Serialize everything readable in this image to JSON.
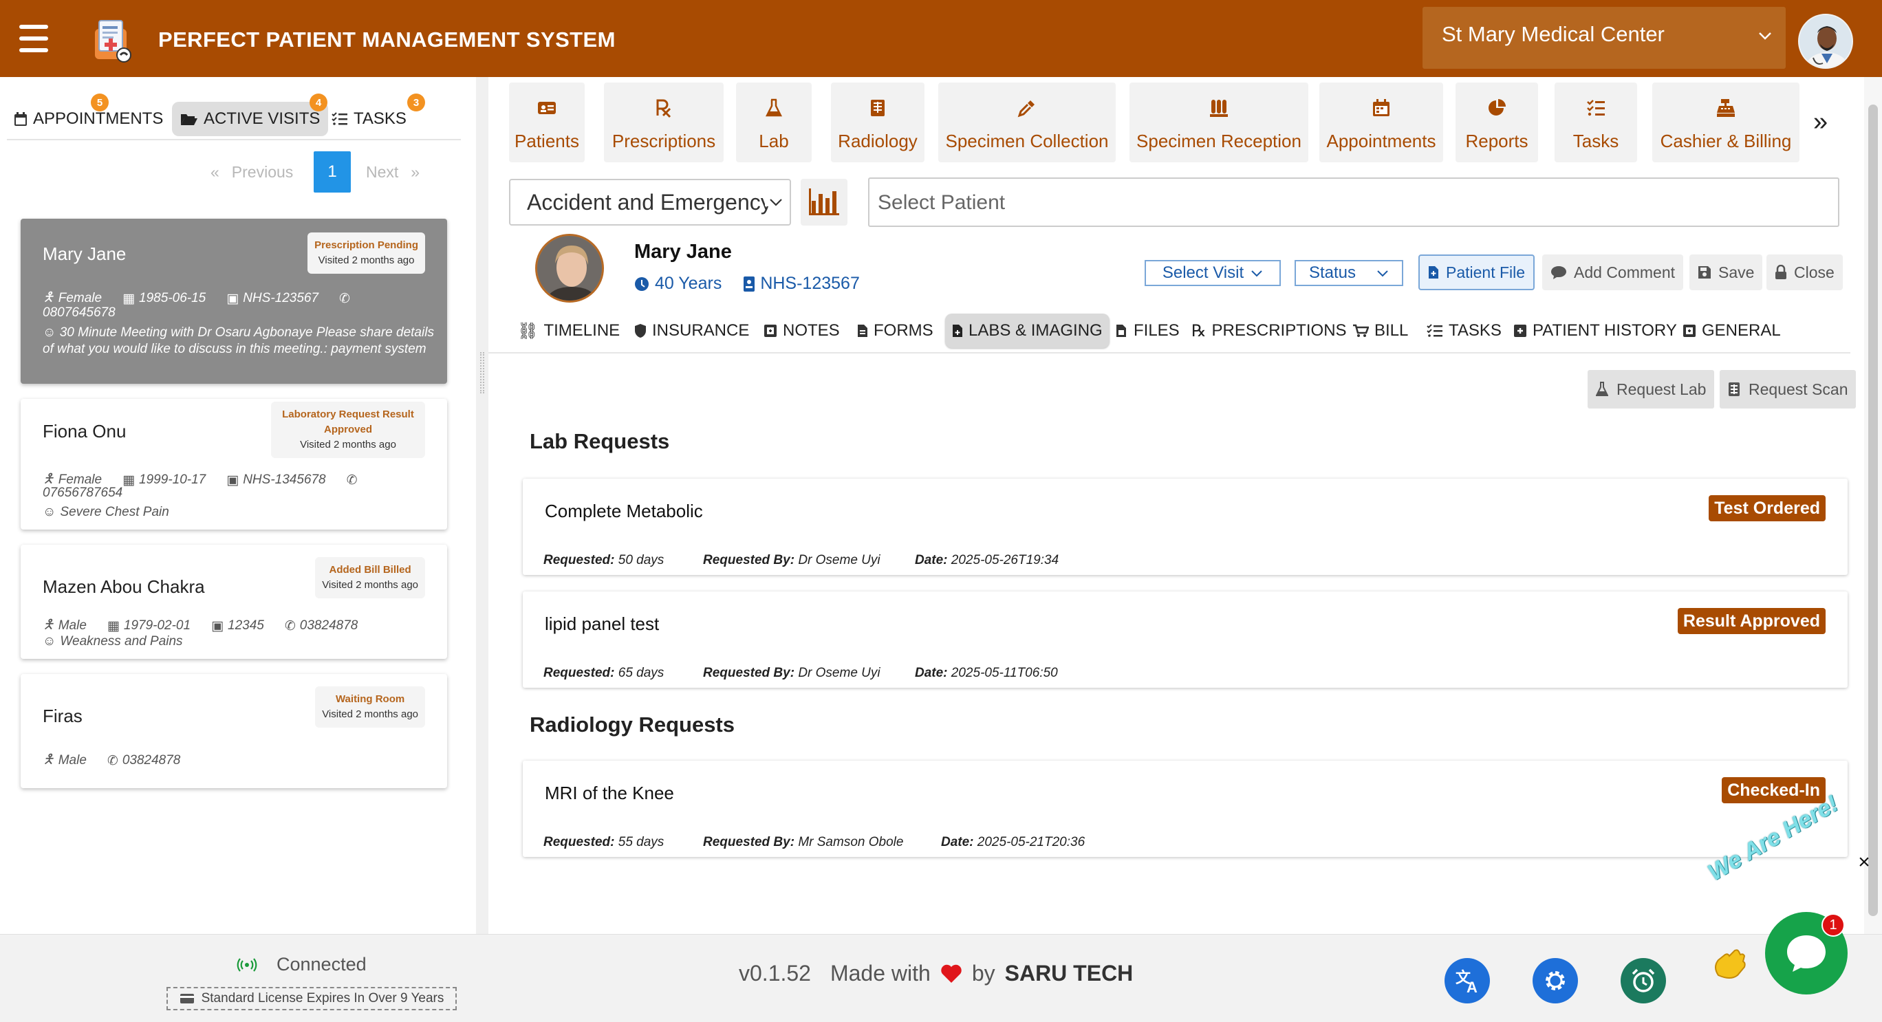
{
  "header": {
    "title": "PERFECT PATIENT MANAGEMENT SYSTEM",
    "facility": "St Mary Medical Center",
    "brand_color": "#a84b02"
  },
  "left": {
    "tabs": [
      {
        "label": "APPOINTMENTS",
        "badge": "5",
        "icon": "calendar-icon"
      },
      {
        "label": "ACTIVE VISITS",
        "badge": "4",
        "icon": "folder-open-icon"
      },
      {
        "label": "TASKS",
        "badge": "3",
        "icon": "task-list-icon"
      }
    ],
    "pager": {
      "previous": "Previous",
      "current": "1",
      "next": "Next"
    },
    "visits": [
      {
        "name": "Mary Jane",
        "status": "Prescription Pending",
        "visited": "Visited 2 months ago",
        "gender": "Female",
        "dob": "1985-06-15",
        "nhs": "NHS-123567",
        "phone": "0807645678",
        "note": "30 Minute Meeting with Dr Osaru Agbonaye Please share details of what you would like to discuss in this meeting.: payment system"
      },
      {
        "name": "Fiona Onu",
        "status": "Laboratory Request Result Approved",
        "visited": "Visited 2 months ago",
        "gender": "Female",
        "dob": "1999-10-17",
        "nhs": "NHS-1345678",
        "phone": "07656787654",
        "note": "Severe Chest Pain"
      },
      {
        "name": "Mazen Abou Chakra",
        "status": "Added Bill Billed",
        "visited": "Visited 2 months ago",
        "gender": "Male",
        "dob": "1979-02-01",
        "nhs": "12345",
        "phone": "03824878",
        "note": "Weakness and Pains"
      },
      {
        "name": "Firas",
        "status": "Waiting Room",
        "visited": "Visited 2 months ago",
        "gender": "Male",
        "phone": "03824878"
      }
    ]
  },
  "nav": {
    "tiles": [
      {
        "label": "Patients",
        "icon": "id-card-icon"
      },
      {
        "label": "Prescriptions",
        "icon": "prescription-icon"
      },
      {
        "label": "Lab",
        "icon": "flask-icon"
      },
      {
        "label": "Radiology",
        "icon": "radiology-icon"
      },
      {
        "label": "Specimen Collection",
        "icon": "eyedropper-icon"
      },
      {
        "label": "Specimen Reception",
        "icon": "vials-icon"
      },
      {
        "label": "Appointments",
        "icon": "calendar-icon"
      },
      {
        "label": "Reports",
        "icon": "pie-chart-icon"
      },
      {
        "label": "Tasks",
        "icon": "task-list-icon"
      },
      {
        "label": "Cashier & Billing",
        "icon": "cash-register-icon"
      }
    ],
    "more": "»"
  },
  "toolbar": {
    "department": "Accident and Emergency",
    "patient_placeholder": "Select  Patient"
  },
  "patient": {
    "name": "Mary Jane",
    "age": "40 Years",
    "nhs": "NHS-123567",
    "select_visit": "Select Visit",
    "status": "Status",
    "actions": {
      "patient_file": "Patient File",
      "add_comment": "Add Comment",
      "save": "Save",
      "close": "Close"
    }
  },
  "patient_tabs": [
    {
      "label": "TIMELINE",
      "icon": "timeline-icon"
    },
    {
      "label": "INSURANCE",
      "icon": "shield-icon"
    },
    {
      "label": "NOTES",
      "icon": "notes-icon"
    },
    {
      "label": "FORMS",
      "icon": "form-icon"
    },
    {
      "label": "LABS & IMAGING",
      "icon": "file-medical-icon"
    },
    {
      "label": "FILES",
      "icon": "files-icon"
    },
    {
      "label": "PRESCRIPTIONS",
      "icon": "prescription-icon"
    },
    {
      "label": "BILL",
      "icon": "cart-icon"
    },
    {
      "label": "TASKS",
      "icon": "task-list-icon"
    },
    {
      "label": "PATIENT HISTORY",
      "icon": "history-icon"
    },
    {
      "label": "GENERAL",
      "icon": "general-icon"
    }
  ],
  "labs": {
    "request_lab": "Request Lab",
    "request_scan": "Request Scan",
    "lab_heading": "Lab Requests",
    "radiology_heading": "Radiology Requests",
    "labels": {
      "requested": "Requested:",
      "requested_by": "Requested By:",
      "date": "Date:"
    },
    "lab_requests": [
      {
        "title": "Complete Metabolic",
        "status": "Test Ordered",
        "requested": "50 days",
        "by": "Dr Oseme Uyi",
        "date": "2025-05-26T19:34"
      },
      {
        "title": "lipid panel test",
        "status": "Result Approved",
        "requested": "65 days",
        "by": "Dr Oseme Uyi",
        "date": "2025-05-11T06:50"
      }
    ],
    "radiology_requests": [
      {
        "title": "MRI of the Knee",
        "status": "Checked-In",
        "requested": "55 days",
        "by": "Mr Samson Obole",
        "date": "2025-05-21T20:36"
      }
    ]
  },
  "footer": {
    "connection": "Connected",
    "license": "Standard License Expires In Over 9 Years",
    "version": "v0.1.52",
    "made_with": "Made with",
    "by": "by",
    "company": "SARU TECH"
  },
  "chat": {
    "bubble_text": "We Are Here!",
    "unread": "1"
  }
}
